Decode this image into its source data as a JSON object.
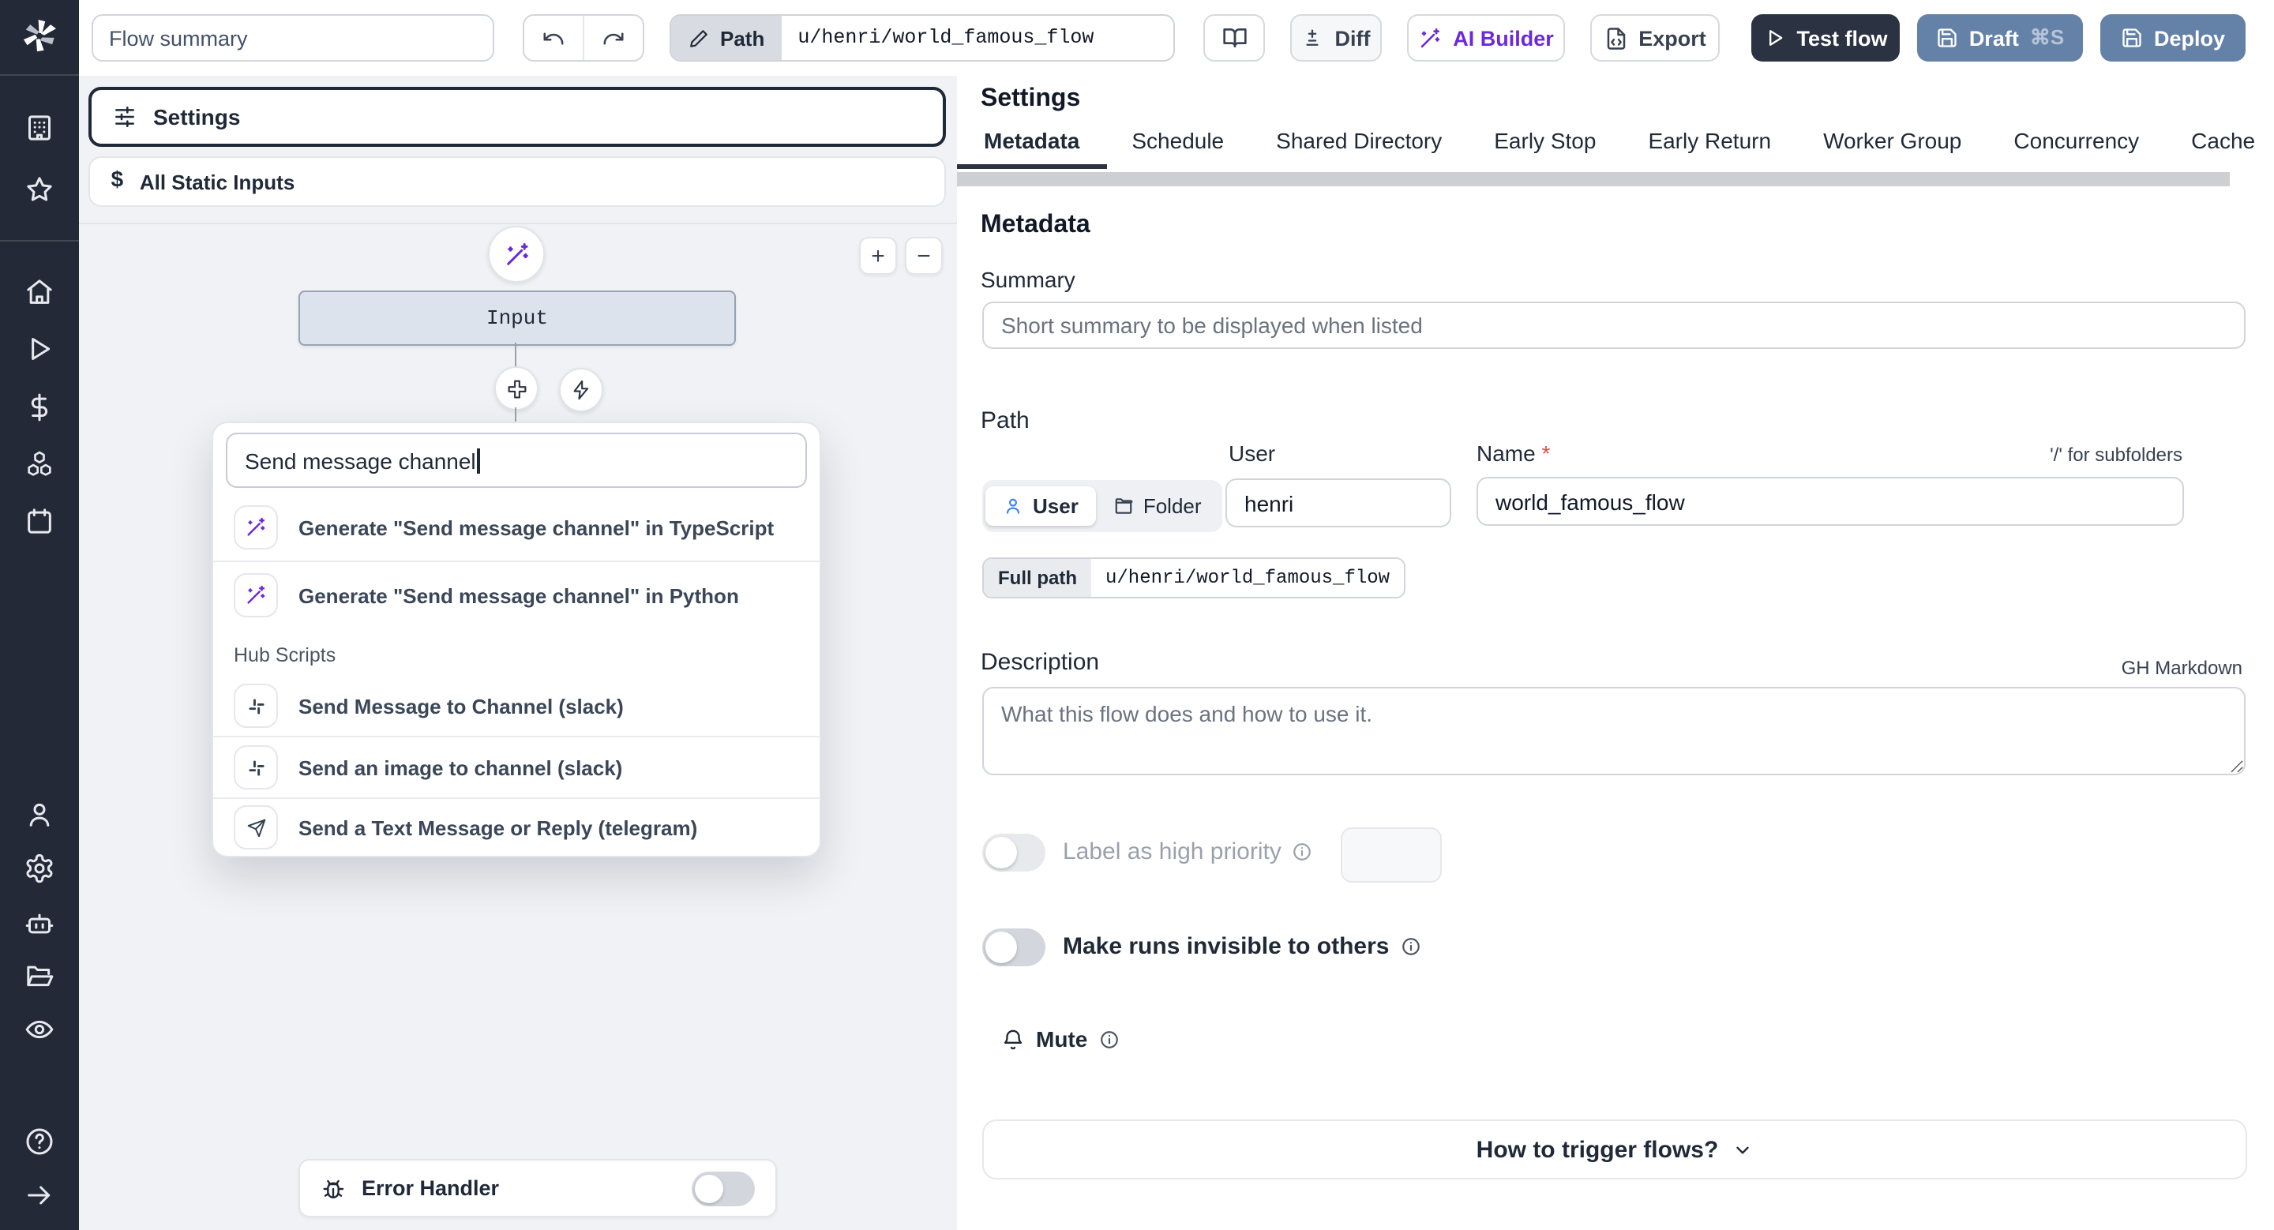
{
  "topbar": {
    "flow_summary_value": "Flow summary",
    "path_label": "Path",
    "path_value": "u/henri/world_famous_flow",
    "diff_label": "Diff",
    "ai_builder_label": "AI Builder",
    "export_label": "Export",
    "test_flow_label": "Test flow",
    "draft_label": "Draft",
    "draft_shortcut": "⌘S",
    "deploy_label": "Deploy"
  },
  "sidebar": {
    "icons": [
      "windmill-logo",
      "building",
      "star",
      "home",
      "play",
      "dollar",
      "boxes",
      "calendar",
      "user",
      "settings-gear",
      "bot",
      "folder-open",
      "eye",
      "help",
      "arrow-right"
    ]
  },
  "left_panel": {
    "settings_card_label": "Settings",
    "static_inputs_label": "All Static Inputs",
    "input_node_label": "Input",
    "zoom_in_label": "+",
    "zoom_out_label": "−",
    "search_value": "Send message channel",
    "results": [
      {
        "icon": "magic-wand",
        "label": "Generate \"Send message channel\" in TypeScript"
      },
      {
        "icon": "magic-wand",
        "label": "Generate \"Send message channel\" in Python"
      }
    ],
    "hub_header": "Hub Scripts",
    "hub_items": [
      {
        "icon": "slack",
        "label": "Send Message to Channel (slack)"
      },
      {
        "icon": "slack",
        "label": "Send an image to channel (slack)"
      },
      {
        "icon": "telegram-send",
        "label": "Send a Text Message or Reply (telegram)"
      }
    ],
    "error_handler_label": "Error Handler"
  },
  "settings_panel": {
    "title": "Settings",
    "tabs": [
      "Metadata",
      "Schedule",
      "Shared Directory",
      "Early Stop",
      "Early Return",
      "Worker Group",
      "Concurrency",
      "Cache"
    ],
    "active_tab": "Metadata",
    "metadata": {
      "heading": "Metadata",
      "summary_label": "Summary",
      "summary_placeholder": "Short summary to be displayed when listed",
      "path_label": "Path",
      "user_col_label": "User",
      "name_label": "Name",
      "required_marker": "*",
      "subfolder_hint": "'/' for subfolders",
      "owner_user_label": "User",
      "owner_folder_label": "Folder",
      "user_value": "henri",
      "name_value": "world_famous_flow",
      "full_path_label": "Full path",
      "full_path_value": "u/henri/world_famous_flow",
      "description_label": "Description",
      "markdown_hint": "GH Markdown",
      "description_placeholder": "What this flow does and how to use it.",
      "high_priority_label": "Label as high priority",
      "invisible_label": "Make runs invisible to others",
      "mute_label": "Mute",
      "trigger_help_label": "How to trigger flows?"
    }
  },
  "colors": {
    "sidebar_bg": "#232936",
    "dark_button": "#2b3342",
    "steel_blue_button": "#6481a8",
    "ai_purple": "#6d28d9",
    "node_fill": "#dde3ec",
    "canvas_bg": "#f1f2f5",
    "required_red": "#ef4444"
  }
}
